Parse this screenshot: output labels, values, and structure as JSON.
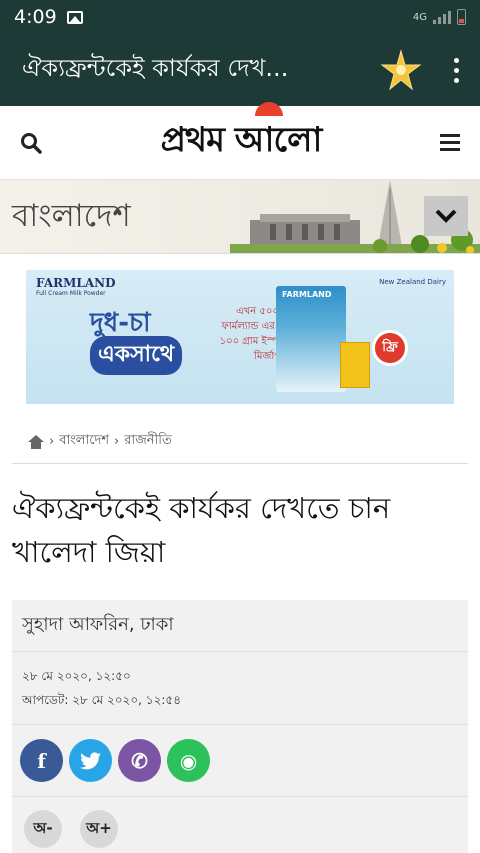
{
  "status": {
    "time": "4:09",
    "network": "4G"
  },
  "app_bar": {
    "title": "ঐক্যফ্রন্টকেই কার্যকর দেখ..."
  },
  "site": {
    "logo_text": "প্রথম আলো"
  },
  "section": {
    "title": "বাংলাদেশ"
  },
  "ad": {
    "brand": "FARMLAND",
    "brand_sub": "Full Cream Milk Powder",
    "slogan_line1": "দুধ-চা",
    "slogan_line2": "একসাথে",
    "offer": "এখন ৫০০ গ্রাম ফার্মল্যান্ড এর সাথে ১০০ গ্রাম ইস্পাহানি মির্জাপুর চা",
    "pack_label": "FARMLAND",
    "free_label": "ফ্রি",
    "nz_label": "New Zealand Dairy"
  },
  "breadcrumb": {
    "items": [
      "বাংলাদেশ",
      "রাজনীতি"
    ],
    "separator": "›"
  },
  "article": {
    "headline": "ঐক্যফ্রন্টকেই কার্যকর দেখতে চান খালেদা জিয়া",
    "author": "সুহাদা আফরিন, ঢাকা",
    "published": "২৮ মে ২০২০, ১২:৫০",
    "updated": "আপডেট: ২৮ মে ২০২০, ১২:৫৪"
  },
  "share": {
    "facebook": "f",
    "twitter": "t",
    "viber": "✆",
    "whatsapp": "◉"
  },
  "font_controls": {
    "decrease": "অ-",
    "increase": "অ+"
  },
  "colors": {
    "app_bar": "#1e3a36",
    "logo_red": "#e8402c",
    "facebook": "#3a5a97",
    "twitter": "#27a5e6",
    "viber": "#7b55a3",
    "whatsapp": "#2cc15a"
  }
}
